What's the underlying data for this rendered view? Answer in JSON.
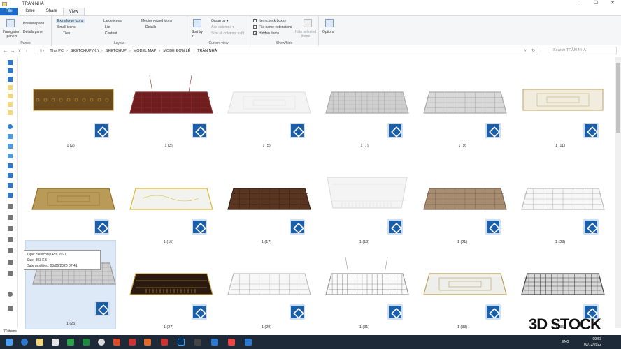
{
  "window": {
    "title": "TRẦN NHÀ",
    "min": "—",
    "max": "☐",
    "close": "✕"
  },
  "tabs": {
    "file": "File",
    "home": "Home",
    "share": "Share",
    "view": "View"
  },
  "ribbon": {
    "panes": {
      "navigation": "Navigation pane ▾",
      "preview": "Preview pane",
      "details": "Details pane",
      "label": "Panes"
    },
    "layout": {
      "extra_large": "Extra large icons",
      "large": "Large icons",
      "medium": "Medium-sized icons",
      "small": "Small icons",
      "list": "List",
      "details": "Details",
      "tiles": "Tiles",
      "content": "Content",
      "label": "Layout"
    },
    "current_view": {
      "sort": "Sort by ▾",
      "group": "Group by ▾",
      "add_columns": "Add columns ▾",
      "size_all": "Size all columns to fit",
      "label": "Current view"
    },
    "show_hide": {
      "checkboxes": "Item check boxes",
      "extensions": "File name extensions",
      "hidden": "Hidden items",
      "hide_selected": "Hide selected items",
      "label": "Show/hide"
    },
    "options": "Options"
  },
  "address": {
    "crumbs": [
      "This PC",
      "SKETCHUP (K:)",
      "SKETCHUP",
      "MODEL MAP",
      "MODE ĐƠN LẺ",
      "TRẦN NHÀ"
    ],
    "search_placeholder": "Search TRẦN NHÀ"
  },
  "items": [
    {
      "caption": "1 (2)",
      "theme": "ornate-brown"
    },
    {
      "caption": "1 (3)",
      "theme": "dark-red-grid"
    },
    {
      "caption": "1 (5)",
      "theme": "white-tray"
    },
    {
      "caption": "1 (7)",
      "theme": "grey-grid"
    },
    {
      "caption": "1 (9)",
      "theme": "grey-coffer"
    },
    {
      "caption": "1 (11)",
      "theme": "classic-gold"
    },
    {
      "caption": "1 (13)",
      "theme": "gold-tray"
    },
    {
      "caption": "1 (15)",
      "theme": "yellow-wave"
    },
    {
      "caption": "1 (17)",
      "theme": "wood-panels"
    },
    {
      "caption": "1 (19)",
      "theme": "white-beam"
    },
    {
      "caption": "1 (21)",
      "theme": "mosaic"
    },
    {
      "caption": "1 (23)",
      "theme": "white-grid"
    },
    {
      "caption": "1 (25)",
      "theme": "wave-panels"
    },
    {
      "caption": "1 (27)",
      "theme": "dark-wood-stripe"
    },
    {
      "caption": "1 (29)",
      "theme": "white-grid"
    },
    {
      "caption": "1 (31)",
      "theme": "wire-mesh"
    },
    {
      "caption": "1 (33)",
      "theme": "gold-frame"
    },
    {
      "caption": "1 (35)",
      "theme": "dark-louvre"
    }
  ],
  "tooltip": {
    "type": "Type: SketchUp Pro 2021",
    "size": "Size: 303 KB",
    "date": "Date modified: 08/06/2020 07:41"
  },
  "status": {
    "count": "70 items"
  },
  "tray": {
    "lang": "ENG",
    "time": "09:53",
    "date": "02/12/2022"
  },
  "watermark": "3D STOCK",
  "colors": {
    "accent": "#1e6cc8",
    "sketchup_badge": "#1b5fa8",
    "taskbar": "#1f2a38"
  }
}
